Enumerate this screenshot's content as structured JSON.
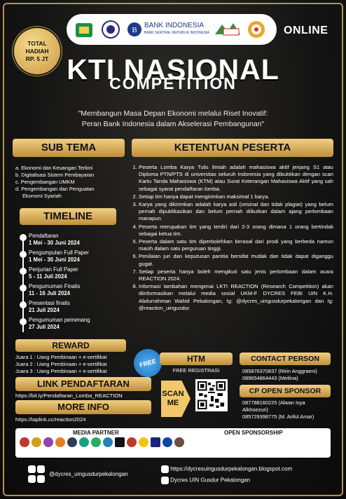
{
  "header": {
    "hadiah_line1": "TOTAL",
    "hadiah_line2": "HADIAH",
    "hadiah_line3": "RP. 5 JT",
    "bi_name": "BANK INDONESIA",
    "bi_sub": "BANK SENTRAL REPUBLIK INDONESIA",
    "online": "ONLINE"
  },
  "title": {
    "main": "KTI NASIONAL",
    "sub": "COMPETITION",
    "tagline_1": "\"Membangun Masa Depan Ekonomi melalui Riset Inovatif:",
    "tagline_2": "Peran Bank Indonesia dalam Akselerasi Pembangunan\""
  },
  "sub_tema": {
    "heading": "SUB TEMA",
    "items": [
      "a. Ekonomi dan Keuangan Terkini",
      "b. Digitalisasi Sistem Pembayaran",
      "c. Pengembangan UMKM",
      "d. Pengembangan dan Penguatan",
      "    Ekonomi Syariah"
    ]
  },
  "timeline": {
    "heading": "TIMELINE",
    "items": [
      {
        "label": "Pendaftaran",
        "date": "1 Mei - 30 Juni 2024"
      },
      {
        "label": "Pengumpulan Full Paper",
        "date": "1 Mei - 30 Juni 2024"
      },
      {
        "label": "Penjurian Full Paper",
        "date": "5 - 11 Juli 2024"
      },
      {
        "label": "Pengumuman Finalis",
        "date": "11 - 16 Juli 2024"
      },
      {
        "label": "Presentasi finalis",
        "date": "21 Juli 2024"
      },
      {
        "label": "Pengumuman pemenang",
        "date": "27 Juli 2024"
      }
    ]
  },
  "ketentuan": {
    "heading": "KETENTUAN PESERTA",
    "items": [
      "Peserta Lomba Karya Tulis Ilmiah adalah mahasiswa aktif jenjang S1 atau Diploma PTN/PTS di universitas seluruh Indonesia yang dibuktikan dengan scan Kartu Tanda Mahasiswa (KTM) atau Surat Keterangan Mahasiswa Aktif yang sah sebagai syarat pendaftaran lomba.",
      "Setiap tim hanya dapat mengirimkan maksimal 1 karya.",
      "Karya yang dikirimkan adalah karya asli (orisinal dan tidak plagiat) yang belum pernah dipublikasikan dan belum pernah diikutkan dalam ajang perlombaan manapun.",
      "Peserta merupakan tim yang terdiri dari 2-3 orang dimana 1 orang bertindak sebagai ketua tim.",
      "Peserta dalam satu tim diperbolehkan berasal dari prodi yang berbeda namun masih dalam satu perguruan tinggi.",
      "Penilaian juri dan keputusan panitia bersifat mutlak dan tidak dapat diganggu gugat.",
      "Setiap peserta hanya boleh mengikuti satu jenis perlombaan dalam acara REACTION 2024.",
      "Informasi tambahan mengenai LKTI REACTION (Research Competition) akan diinformasikan melalui media sosial UKM-F DYCRES FEBI UIN K.H. Abdurrahman Wahid Pekalongan, Ig: @dycres_uingusdurpekalongan dan Ig: @reaction_uingusdur."
    ]
  },
  "reward": {
    "heading": "REWARD",
    "items": [
      "Juara 1 : Uang Pembinaan + e-sertifikat",
      "Juara 2 : Uang Pembinaan + e-sertifikat",
      "Juara 3 : Uang Pembinaan + e-sertifikat"
    ]
  },
  "link_pendaftaran": {
    "heading": "LINK PENDAFTARAN",
    "url": "https://bit.ly/Pendaftaran_Lomba_REACTION"
  },
  "more_info": {
    "heading": "MORE INFO",
    "url": "https://taplink.cc/reaction2024"
  },
  "htm": {
    "free_badge": "FREE",
    "heading": "HTM",
    "value": "FREE REGISTRASI",
    "scan_line1": "SCAN",
    "scan_line2": "ME"
  },
  "contact": {
    "heading": "CONTACT PERSON",
    "items": [
      "085876370837 (Ririn Anggraeni)",
      "089654864443 (Meilina)"
    ]
  },
  "sponsor": {
    "heading": "CP OPEN SPONSOR",
    "items": [
      "087788160225 (Alwan Isya",
      "Alkhoezuri)",
      "085729398775 (M. Ariful Amar)"
    ]
  },
  "partner": {
    "media_partner": "MEDIA PARTNER",
    "open_sponsorship": "OPEN SPONSORSHIP"
  },
  "footer": {
    "instagram": "@dycres_uingusdurpekalongan",
    "blog": "https://dycresuingusdurpekalongan.blogspot.com",
    "youtube": "Dycres UIN Gusdur Pekalongan"
  },
  "colors": {
    "gold": "#d9ad5a",
    "background": "#141414"
  }
}
